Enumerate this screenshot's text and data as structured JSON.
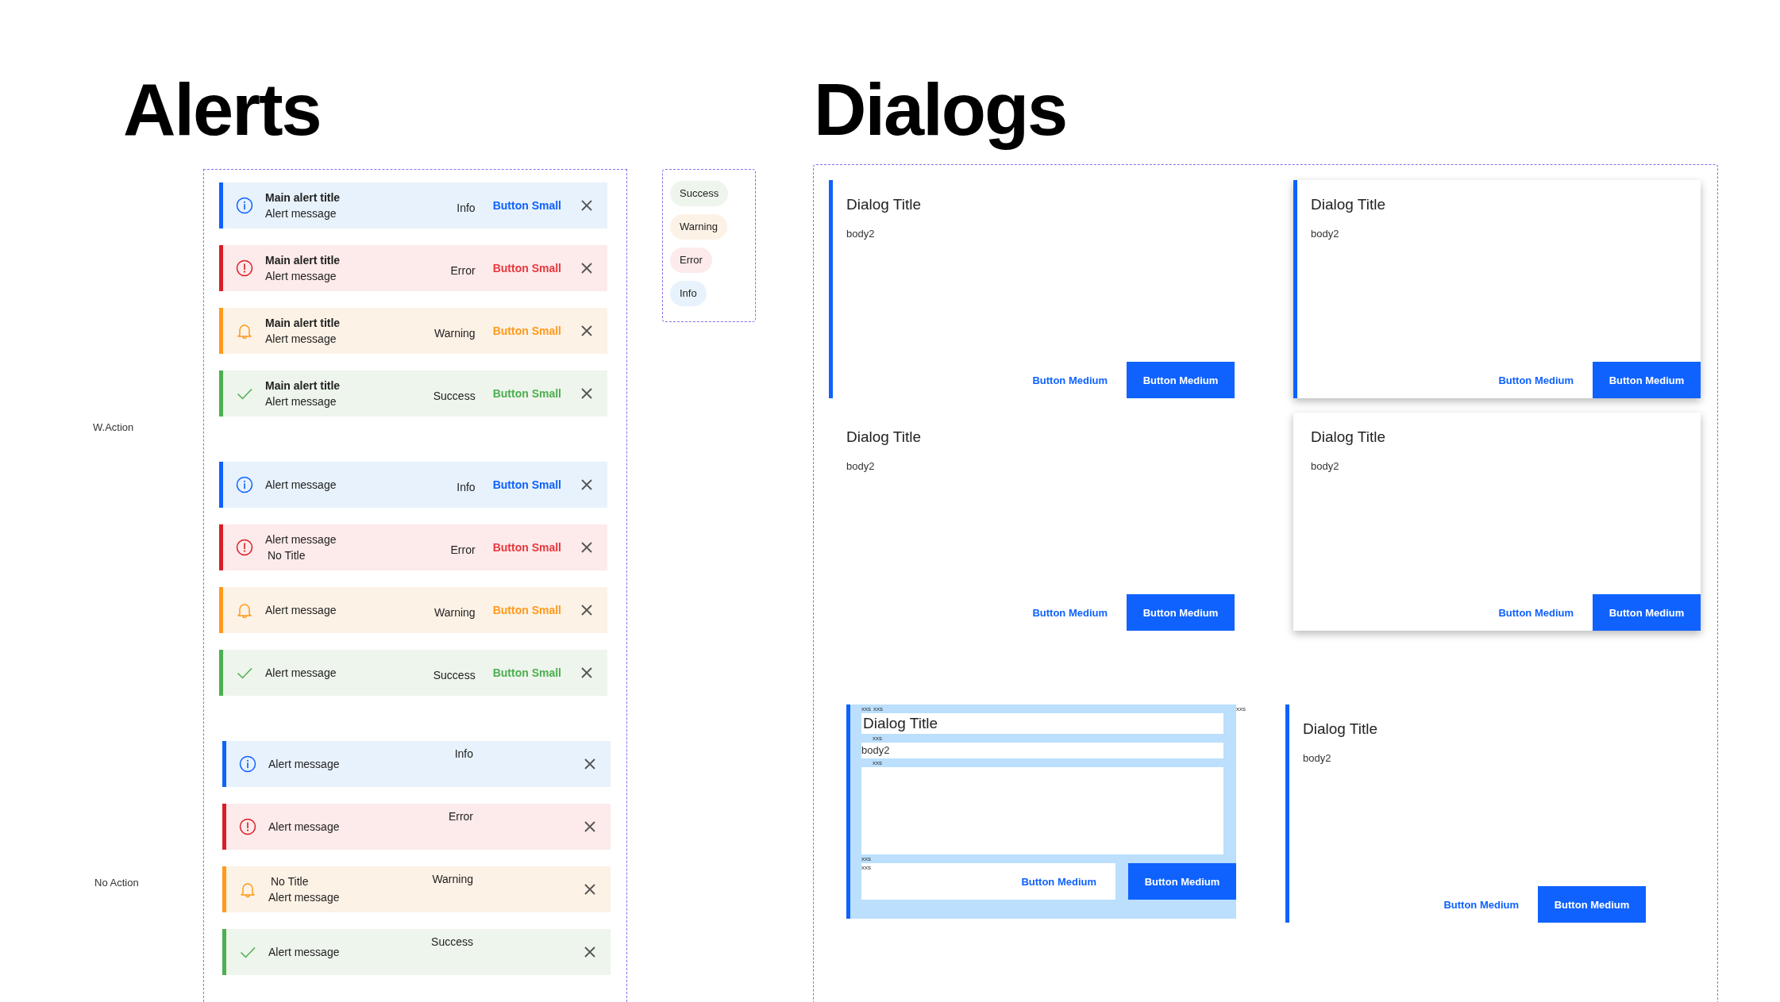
{
  "alerts": {
    "heading": "Alerts",
    "side_labels": [
      "W.Action",
      "No Action"
    ],
    "groups": [
      {
        "action": true,
        "items": [
          {
            "kind": "info",
            "lines": [
              {
                "kind": "title",
                "text": "Main alert title"
              },
              {
                "kind": "message",
                "text": "Alert message"
              }
            ],
            "label": "Info",
            "button": "Button Small"
          },
          {
            "kind": "error",
            "lines": [
              {
                "kind": "title",
                "text": "Main alert title"
              },
              {
                "kind": "message",
                "text": "Alert message"
              }
            ],
            "label": "Error",
            "button": "Button Small"
          },
          {
            "kind": "warning",
            "lines": [
              {
                "kind": "title",
                "text": "Main alert title"
              },
              {
                "kind": "message",
                "text": "Alert message"
              }
            ],
            "label": "Warning",
            "button": "Button Small"
          },
          {
            "kind": "success",
            "lines": [
              {
                "kind": "title",
                "text": "Main alert title"
              },
              {
                "kind": "message",
                "text": "Alert message"
              }
            ],
            "label": "Success",
            "button": "Button Small"
          }
        ]
      },
      {
        "action": true,
        "items": [
          {
            "kind": "info",
            "lines": [
              {
                "kind": "message",
                "text": "Alert message"
              }
            ],
            "label": "Info",
            "button": "Button Small"
          },
          {
            "kind": "error",
            "lines": [
              {
                "kind": "message",
                "text": "Alert message"
              },
              {
                "kind": "note",
                "text": "No Title"
              }
            ],
            "label": "Error",
            "button": "Button Small"
          },
          {
            "kind": "warning",
            "lines": [
              {
                "kind": "message",
                "text": "Alert message"
              }
            ],
            "label": "Warning",
            "button": "Button Small"
          },
          {
            "kind": "success",
            "lines": [
              {
                "kind": "message",
                "text": "Alert message"
              }
            ],
            "label": "Success",
            "button": "Button Small"
          }
        ]
      },
      {
        "action": false,
        "items": [
          {
            "kind": "info",
            "lines": [
              {
                "kind": "message",
                "text": "Alert message"
              }
            ],
            "label": "Info"
          },
          {
            "kind": "error",
            "lines": [
              {
                "kind": "message",
                "text": "Alert message"
              }
            ],
            "label": "Error"
          },
          {
            "kind": "warning",
            "lines": [
              {
                "kind": "note",
                "text": "No Title"
              },
              {
                "kind": "message",
                "text": "Alert message"
              }
            ],
            "label": "Warning"
          },
          {
            "kind": "success",
            "lines": [
              {
                "kind": "message",
                "text": "Alert message"
              }
            ],
            "label": "Success"
          }
        ]
      }
    ],
    "tags": [
      {
        "kind": "success",
        "label": "Success"
      },
      {
        "kind": "warning",
        "label": "Warning"
      },
      {
        "kind": "error",
        "label": "Error"
      },
      {
        "kind": "info",
        "label": "Info"
      }
    ]
  },
  "dialogs": {
    "heading": "Dialogs",
    "items": [
      {
        "kind": "standard",
        "accent": true,
        "elevated": false,
        "title": "Dialog Title",
        "body": "body2",
        "buttons": [
          "Button Medium",
          "Button Medium"
        ]
      },
      {
        "kind": "standard",
        "accent": true,
        "elevated": true,
        "title": "Dialog Title",
        "body": "body2",
        "buttons": [
          "Button Medium",
          "Button Medium"
        ]
      },
      {
        "kind": "standard",
        "accent": false,
        "elevated": false,
        "title": "Dialog Title",
        "body": "body2",
        "buttons": [
          "Button Medium",
          "Button Medium"
        ]
      },
      {
        "kind": "standard",
        "accent": false,
        "elevated": true,
        "title": "Dialog Title",
        "body": "body2",
        "buttons": [
          "Button Medium",
          "Button Medium"
        ]
      },
      {
        "kind": "spec",
        "accent": true,
        "elevated": false,
        "title": "Dialog Title",
        "body": "body2",
        "buttons": [
          "Button Medium",
          "Button Medium"
        ],
        "spacing_labels": [
          "xxs",
          "xxs",
          "xxs",
          "xxs",
          "xxs",
          "xxs",
          "xxs"
        ]
      },
      {
        "kind": "inset",
        "accent": true,
        "elevated": false,
        "title": "Dialog Title",
        "body": "body2",
        "buttons": [
          "Button Medium",
          "Button Medium"
        ]
      }
    ]
  }
}
